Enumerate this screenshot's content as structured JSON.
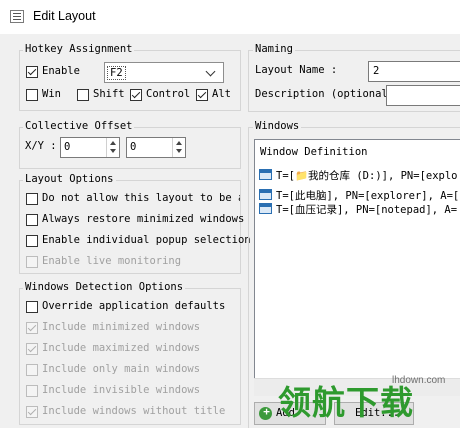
{
  "window": {
    "title": "Edit Layout"
  },
  "hotkey": {
    "group_label": "Hotkey Assignment",
    "enable_label": "Enable",
    "enable_checked": true,
    "key_value": "F2",
    "modifiers": [
      {
        "label": "Win",
        "checked": false
      },
      {
        "label": "Shift",
        "checked": false
      },
      {
        "label": "Control",
        "checked": true
      },
      {
        "label": "Alt",
        "checked": true
      }
    ]
  },
  "offset": {
    "group_label": "Collective Offset",
    "xy_label": "X/Y :",
    "x_value": "0",
    "y_value": "0"
  },
  "layout_options": {
    "group_label": "Layout Options",
    "items": [
      {
        "label": "Do not allow this layout to be ap",
        "checked": false,
        "disabled": false
      },
      {
        "label": "Always restore minimized windows",
        "checked": false,
        "disabled": false
      },
      {
        "label": "Enable individual popup selection",
        "checked": false,
        "disabled": false
      },
      {
        "label": "Enable live monitoring",
        "checked": false,
        "disabled": true
      }
    ]
  },
  "detection": {
    "group_label": "Windows Detection Options",
    "items": [
      {
        "label": "Override application defaults",
        "checked": false,
        "disabled": false
      },
      {
        "label": "Include minimized windows",
        "checked": true,
        "disabled": true
      },
      {
        "label": "Include maximized windows",
        "checked": true,
        "disabled": true
      },
      {
        "label": "Include only main windows",
        "checked": false,
        "disabled": true
      },
      {
        "label": "Include invisible windows",
        "checked": false,
        "disabled": true
      },
      {
        "label": "Include windows without title",
        "checked": true,
        "disabled": true
      }
    ]
  },
  "naming": {
    "group_label": "Naming",
    "layout_name_label": "Layout Name :",
    "layout_name_value": "2",
    "description_label": "Description (optional) :",
    "description_value": ""
  },
  "windows": {
    "group_label": "Windows",
    "header": "Window Definition",
    "rows": [
      "T=[📁我的仓库 (D:)], PN=[explo",
      "T=[此电脑], PN=[explorer], A=[",
      "T=[血压记录], PN=[notepad], A="
    ],
    "add_label": "Add",
    "edit_label": "Edit..."
  },
  "watermark": {
    "main_text": "领航下载",
    "site": "lhdown.com"
  }
}
